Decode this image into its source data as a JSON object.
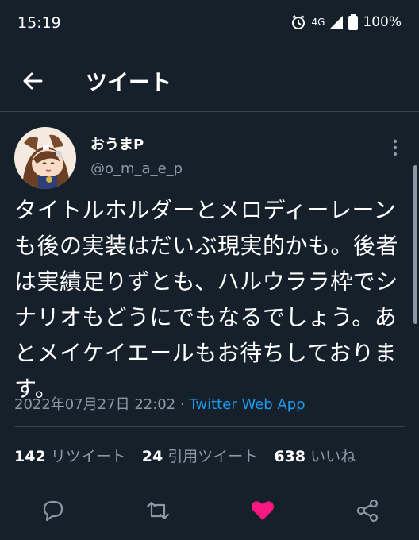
{
  "status": {
    "time": "15:19",
    "network": "4G",
    "battery": "100%"
  },
  "header": {
    "title": "ツイート"
  },
  "tweet": {
    "name": "おうまP",
    "handle": "@o_m_a_e_p",
    "text": "タイトルホルダーとメロディーレーンも後の実装はだいぶ現実的かも。後者は実績足りずとも、ハルウララ枠でシナリオもどうにでもなるでしょう。あとメイケイエールもお待ちしております。",
    "timestamp": "2022年07月27日 22:02",
    "separator": " · ",
    "source": "Twitter Web App"
  },
  "stats": {
    "retweets_count": "142",
    "retweets_label": "リツイート",
    "quotes_count": "24",
    "quotes_label": "引用ツイート",
    "likes_count": "638",
    "likes_label": "いいね"
  },
  "colors": {
    "background": "#15202b",
    "accent": "#1d9bf0",
    "like": "#f91880",
    "muted": "#8b98a5"
  }
}
